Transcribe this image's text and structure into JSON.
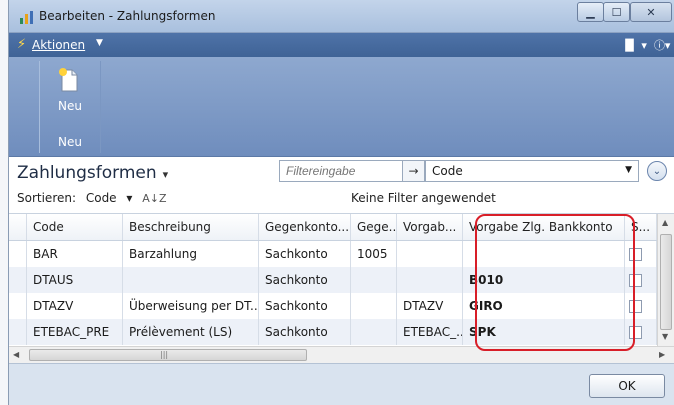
{
  "window": {
    "title": "Bearbeiten - Zahlungsformen",
    "minimize_icon": "minimize-icon",
    "maximize_icon": "maximize-icon",
    "close_icon": "close-icon"
  },
  "actions": {
    "label": "Aktionen",
    "help_icon": "help-icon"
  },
  "ribbon": {
    "new_label": "Neu",
    "group_label": "Neu",
    "new_icon": "new-document-icon"
  },
  "list": {
    "title": "Zahlungsformen",
    "filter_placeholder": "Filtereingabe",
    "field_selected": "Code",
    "sort_label": "Sortieren:",
    "sort_field": "Code",
    "filter_status": "Keine Filter angewendet"
  },
  "grid": {
    "headers": {
      "code": "Code",
      "beschreibung": "Beschreibung",
      "gegenkonto": "Gegenkonto...",
      "gege": "Gege...",
      "vorgab": "Vorgab...",
      "vorgabe_zlg": "Vorgabe Zlg. Bankkonto",
      "s": "S..."
    },
    "rows": [
      {
        "code": "BAR",
        "beschreibung": "Barzahlung",
        "gegenkonto": "Sachkonto",
        "gege": "1005",
        "vorgab": "",
        "vorgabe_zlg": ""
      },
      {
        "code": "DTAUS",
        "beschreibung": "",
        "gegenkonto": "Sachkonto",
        "gege": "",
        "vorgab": "",
        "vorgabe_zlg": "B010"
      },
      {
        "code": "DTAZV",
        "beschreibung": "Überweisung per DT...",
        "gegenkonto": "Sachkonto",
        "gege": "",
        "vorgab": "DTAZV",
        "vorgabe_zlg": "GIRO"
      },
      {
        "code": "ETEBAC_PRE",
        "beschreibung": "Prélèvement (LS)",
        "gegenkonto": "Sachkonto",
        "gege": "",
        "vorgab": "ETEBAC_...",
        "vorgabe_zlg": "SPK"
      }
    ]
  },
  "footer": {
    "ok_label": "OK"
  },
  "colors": {
    "ribbon": "#7f9bc7",
    "actions_bar": "#466a9f",
    "highlight": "#d81e28"
  }
}
